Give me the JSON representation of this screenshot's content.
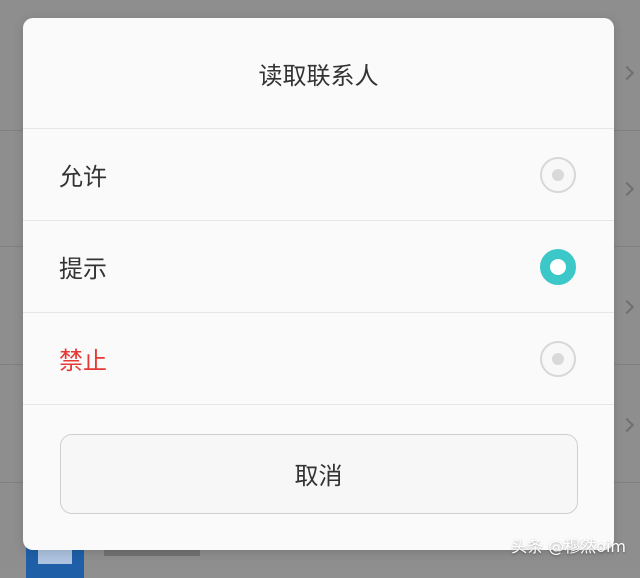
{
  "dialog": {
    "title": "读取联系人",
    "options": [
      {
        "label": "允许",
        "selected": false
      },
      {
        "label": "提示",
        "selected": true
      },
      {
        "label": "禁止",
        "selected": false
      }
    ],
    "cancel_label": "取消"
  },
  "watermark": "头条 @穆然oim",
  "colors": {
    "accent_teal": "#3cc8c8",
    "danger_red": "#e53935",
    "text_dark": "#333333"
  },
  "icons": {
    "background_row_chevron": "chevron-right-icon",
    "radio_unchecked": "radio-unchecked-icon",
    "radio_checked": "radio-checked-icon"
  }
}
